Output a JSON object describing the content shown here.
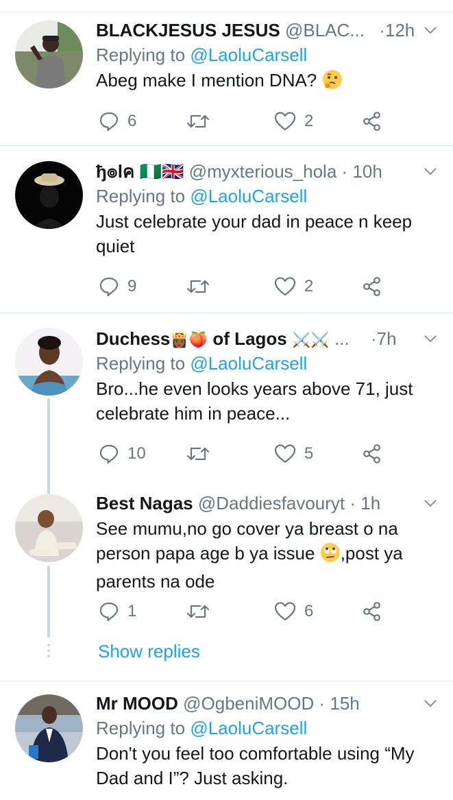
{
  "colors": {
    "link": "#1da1f2",
    "secondary": "#657786",
    "divider": "#e1e8ed",
    "thread": "#ccd6dd"
  },
  "icons": {
    "reply": "reply-icon",
    "retweet": "retweet-icon",
    "like": "heart-icon",
    "share": "share-icon",
    "caret": "chevron-down-icon"
  },
  "tweets": [
    {
      "name": "BLACKJESUS JESUS",
      "handle": "@BLAC...",
      "sep": "·",
      "time": "12h",
      "reply_prefix": "Replying to",
      "reply_to": "@LaoluCarsell",
      "text": "Abeg make I mention DNA?",
      "emoji": "🤔",
      "replies": "6",
      "retweets": "",
      "likes": "2"
    },
    {
      "name": "ђ๏lค 🇳🇬🇬🇧",
      "handle": "@myxterious_hola",
      "sep": "·",
      "time": "10h",
      "reply_prefix": "Replying to",
      "reply_to": "@LaoluCarsell",
      "text": "Just celebrate your dad in peace n keep quiet",
      "replies": "9",
      "retweets": "",
      "likes": "2"
    },
    {
      "name_start": "Duchess",
      "name_emojis": "👸🏾🍑",
      "name_end": "of Lagos",
      "name_tail": "⚔️⚔️",
      "name_more": "...",
      "sep": "·",
      "time": "7h",
      "reply_prefix": "Replying to",
      "reply_to": "@LaoluCarsell",
      "text": "Bro...he even looks years above 71, just celebrate him in peace...",
      "replies": "10",
      "retweets": "",
      "likes": "5"
    },
    {
      "name": "Best Nagas",
      "handle": "@Daddiesfavouryt",
      "sep": "·",
      "time": "1h",
      "text_a": "See mumu,no go cover ya breast o na person papa age b ya issue",
      "emoji": "🙄",
      "text_b": ",post ya parents na ode",
      "replies": "1",
      "retweets": "",
      "likes": "6"
    },
    {
      "name": "Mr MOOD",
      "handle": "@OgbeniMOOD",
      "sep": "·",
      "time": "15h",
      "reply_prefix": "Replying to",
      "reply_to": "@LaoluCarsell",
      "text": "Don't you feel too comfortable using “My Dad and I”? Just asking."
    }
  ],
  "show_replies": "Show replies"
}
